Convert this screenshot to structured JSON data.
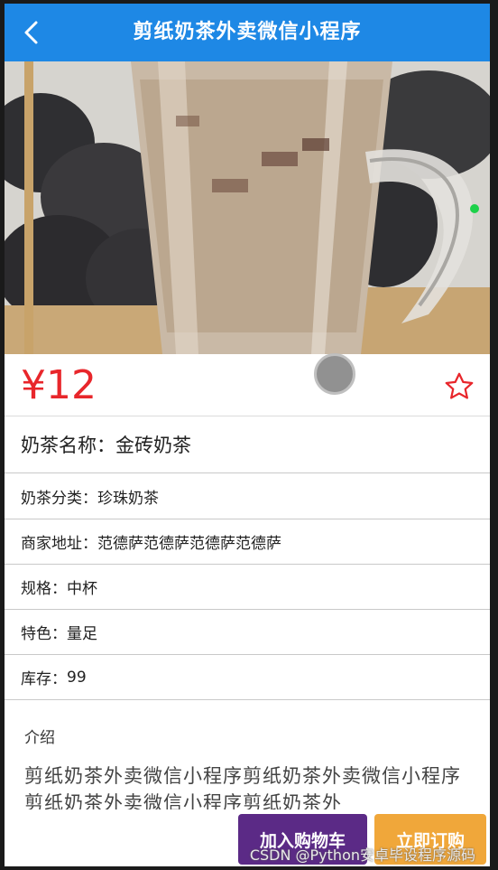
{
  "header": {
    "title": "剪纸奶茶外卖微信小程序",
    "back_icon": "chevron-left-icon"
  },
  "product": {
    "price": "¥12",
    "name_label": "奶茶名称：",
    "name": "金砖奶茶",
    "category_label": "奶茶分类：",
    "category": "珍珠奶茶",
    "address_label": "商家地址：",
    "address": "范德萨范德萨范德萨范德萨",
    "spec_label": "规格：",
    "spec": "中杯",
    "feature_label": "特色：",
    "feature": "量足",
    "stock_label": "库存：",
    "stock": "99",
    "intro_title": "介绍",
    "intro_text": "剪纸奶茶外卖微信小程序剪纸奶茶外卖微信小程序剪纸奶茶外卖微信小程序剪纸奶茶外"
  },
  "actions": {
    "add_cart": "加入购物车",
    "buy_now": "立即订购"
  },
  "watermark": "CSDN @Python安卓毕设程序源码",
  "colors": {
    "header_bg": "#1e88e5",
    "price": "#e8262b",
    "cart_btn": "#5b2a86",
    "buy_btn": "#f0a73a"
  }
}
